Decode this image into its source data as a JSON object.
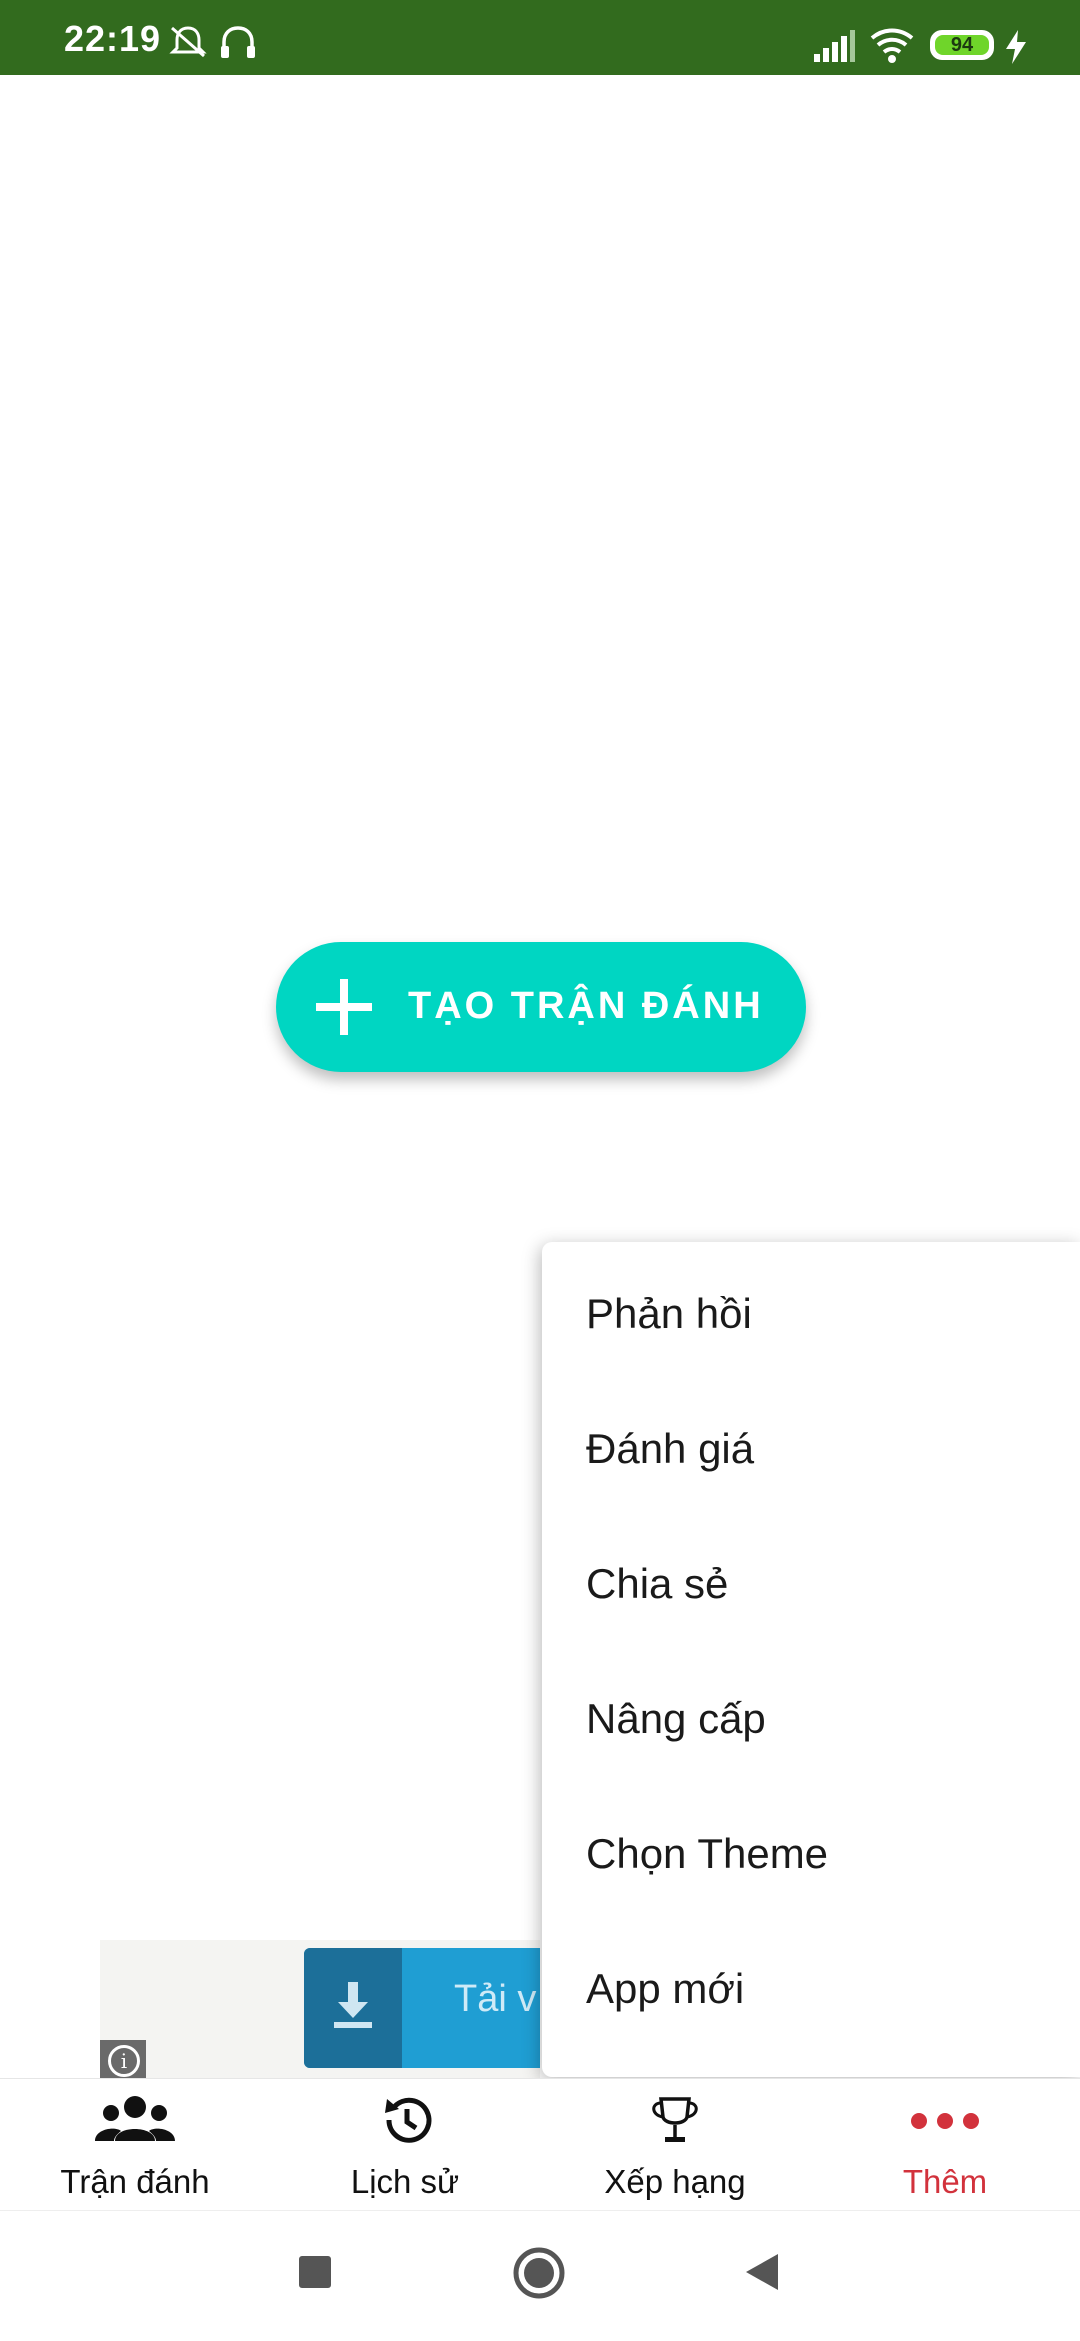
{
  "status_bar": {
    "time": "22:19",
    "battery_level": "94",
    "icons": [
      "mute-icon",
      "headset-icon",
      "signal-icon",
      "wifi-icon",
      "battery-icon",
      "charging-icon"
    ]
  },
  "fab": {
    "icon": "plus-icon",
    "label": "TẠO TRẬN ĐÁNH"
  },
  "ad": {
    "button_label": "Tải v",
    "icons": [
      "download-icon",
      "info-icon"
    ]
  },
  "menu": {
    "items": [
      {
        "label": "Phản hồi"
      },
      {
        "label": "Đánh giá"
      },
      {
        "label": "Chia sẻ"
      },
      {
        "label": "Nâng cấp"
      },
      {
        "label": "Chọn Theme"
      },
      {
        "label": "App mới"
      }
    ]
  },
  "bottom_nav": {
    "items": [
      {
        "label": "Trận đánh",
        "icon": "group-icon",
        "active": false
      },
      {
        "label": "Lịch sử",
        "icon": "history-icon",
        "active": false
      },
      {
        "label": "Xếp hạng",
        "icon": "trophy-icon",
        "active": false
      },
      {
        "label": "Thêm",
        "icon": "more-dots-icon",
        "active": true
      }
    ],
    "active_color": "#d2323c"
  },
  "system_nav": {
    "icons": [
      "recents-square-icon",
      "home-circle-icon",
      "back-triangle-icon"
    ]
  },
  "colors": {
    "status_bar": "#326b1e",
    "fab": "#00d6c2",
    "accent": "#d2323c"
  }
}
